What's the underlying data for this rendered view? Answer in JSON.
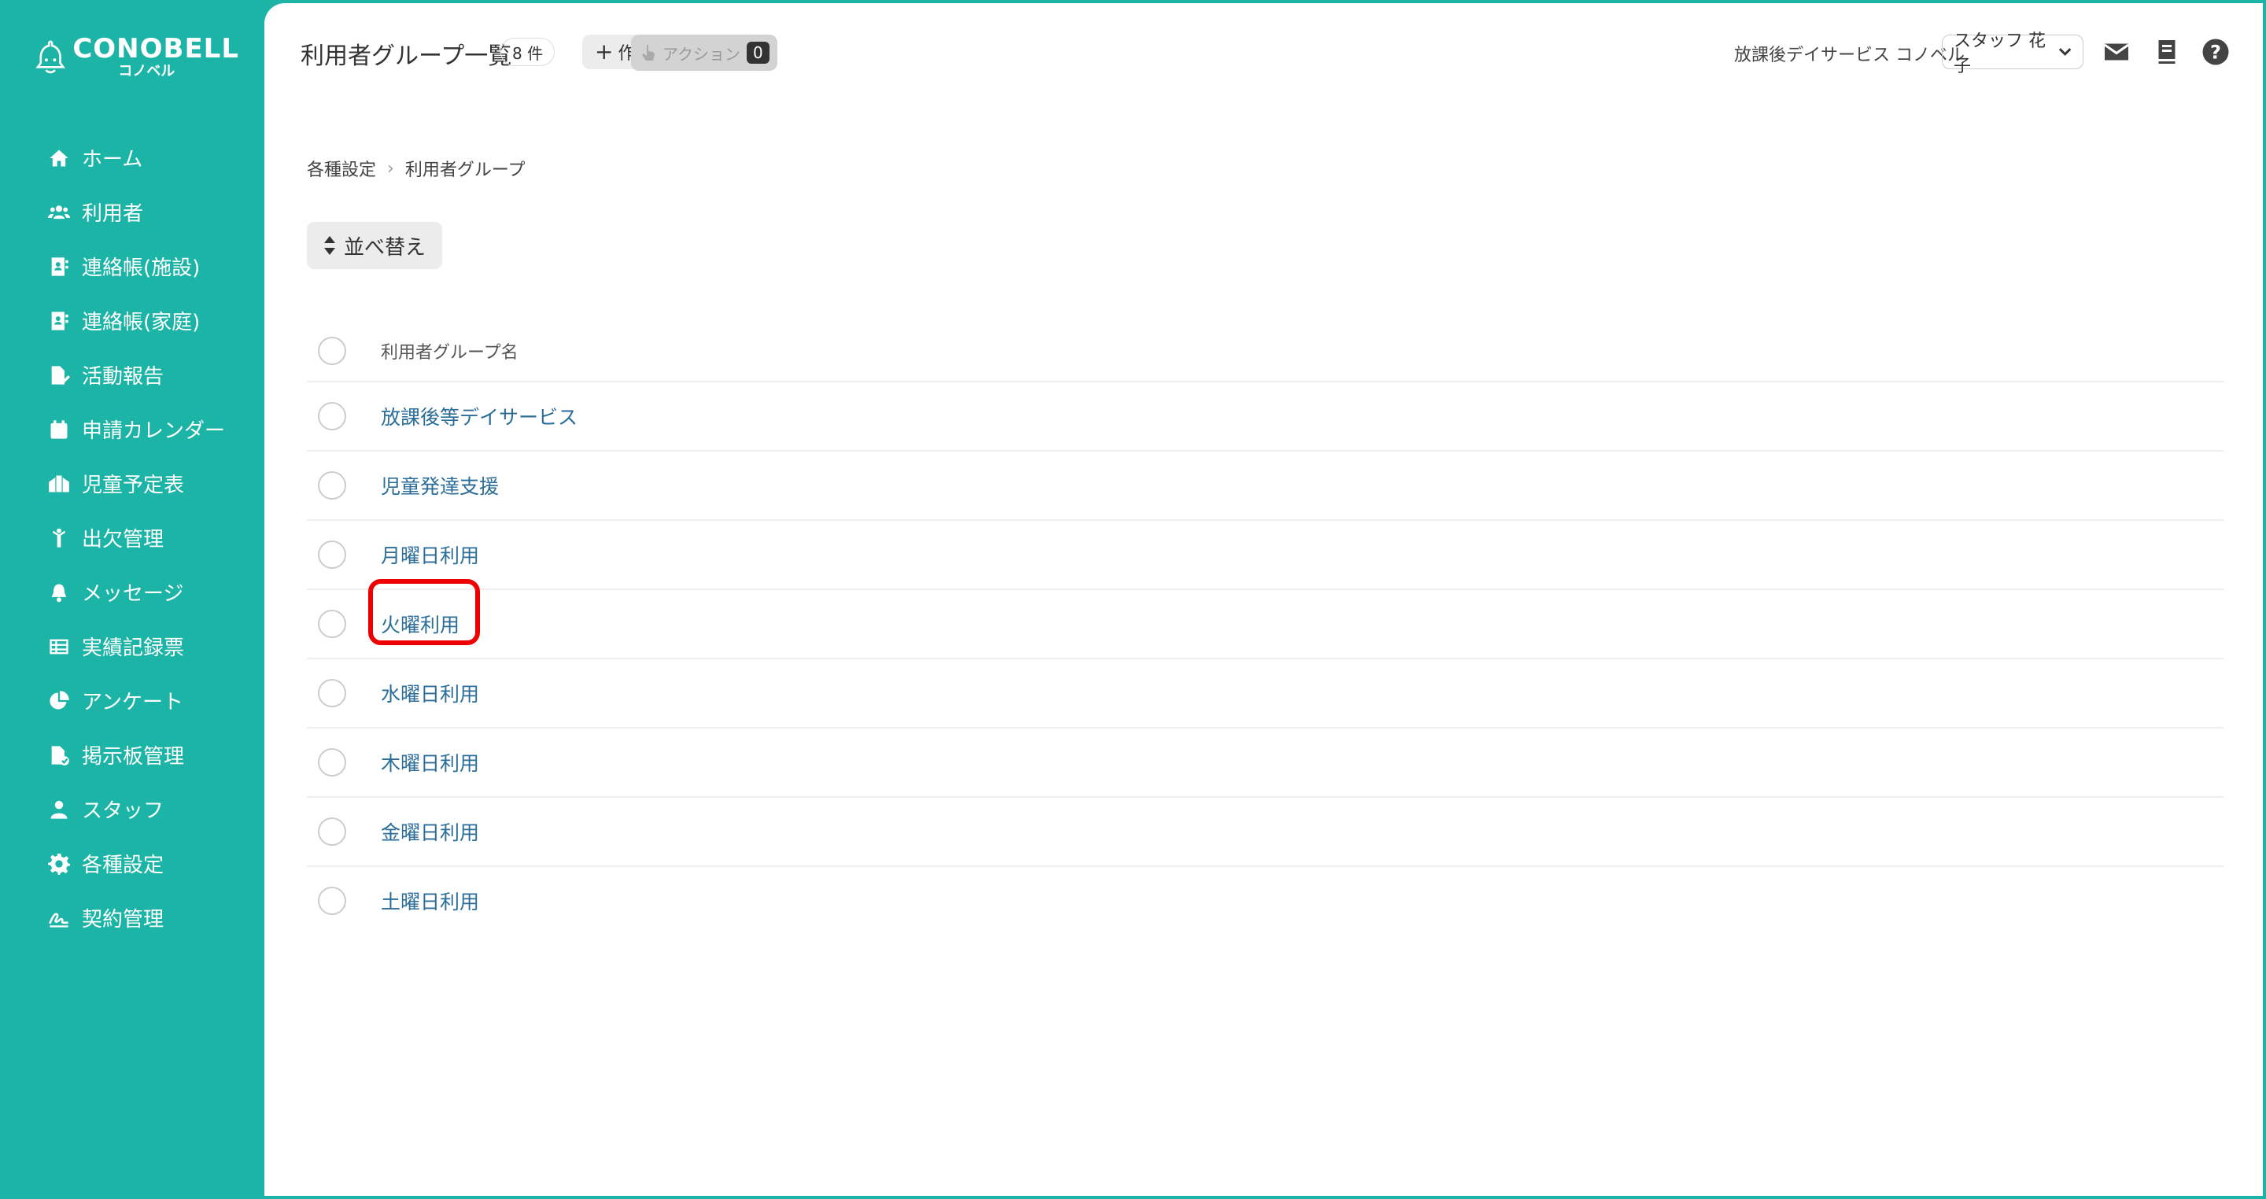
{
  "brand": {
    "name": "CONOBELL",
    "sub": "コノベル"
  },
  "nav": [
    {
      "label": "ホーム",
      "icon": "home-icon"
    },
    {
      "label": "利用者",
      "icon": "users-icon"
    },
    {
      "label": "連絡帳(施設)",
      "icon": "contact-book-icon"
    },
    {
      "label": "連絡帳(家庭)",
      "icon": "contact-book-icon"
    },
    {
      "label": "活動報告",
      "icon": "report-icon"
    },
    {
      "label": "申請カレンダー",
      "icon": "calendar-icon"
    },
    {
      "label": "児童予定表",
      "icon": "schedule-icon"
    },
    {
      "label": "出欠管理",
      "icon": "attendance-icon"
    },
    {
      "label": "メッセージ",
      "icon": "bell-icon"
    },
    {
      "label": "実績記録票",
      "icon": "table-icon"
    },
    {
      "label": "アンケート",
      "icon": "pie-chart-icon"
    },
    {
      "label": "掲示板管理",
      "icon": "board-icon"
    },
    {
      "label": "スタッフ",
      "icon": "staff-icon"
    },
    {
      "label": "各種設定",
      "icon": "gear-icon"
    },
    {
      "label": "契約管理",
      "icon": "contract-icon"
    }
  ],
  "header": {
    "title": "利用者グループ一覧",
    "count": "8 件",
    "create_label": "作成",
    "action_label": "アクション",
    "action_count": "0",
    "facility": "放課後デイサービス コノベル",
    "staff": "スタッフ 花子"
  },
  "breadcrumb": {
    "parent": "各種設定",
    "current": "利用者グループ"
  },
  "sort_label": "並べ替え",
  "table": {
    "header": "利用者グループ名",
    "rows": [
      "放課後等デイサービス",
      "児童発達支援",
      "月曜日利用",
      "火曜利用",
      "水曜日利用",
      "木曜日利用",
      "金曜日利用",
      "土曜日利用"
    ]
  },
  "colors": {
    "sidebar": "#1cb4a6",
    "link": "#2b6d99",
    "highlight": "#ee0000"
  }
}
